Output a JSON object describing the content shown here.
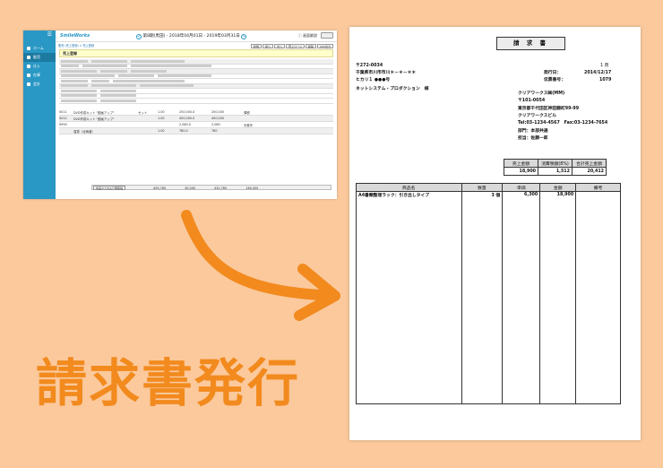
{
  "app": {
    "logo": "SmileWorks",
    "period": "第8期(黒田) - 2018年04月01日 - 2019年03月31日",
    "period_prev": "<",
    "period_next": ">",
    "help": "ⓘ 画面解説",
    "sidebar": [
      {
        "label": "ホーム",
        "icon": "home-icon",
        "active": false
      },
      {
        "label": "販売",
        "icon": "sales-icon",
        "active": true
      },
      {
        "label": "仕入",
        "icon": "purchase-icon",
        "active": false
      },
      {
        "label": "在庫",
        "icon": "stock-icon",
        "active": false
      },
      {
        "label": "会計",
        "icon": "accounting-icon",
        "active": false
      }
    ],
    "breadcrumb": "販売 (売上登録) > 売上登録",
    "toolbar": [
      "新規",
      "前へ",
      "次へ",
      "売上ページ",
      "削除",
      "CSV出力"
    ],
    "form_title": "売上登録",
    "form_buttons": [
      "Q",
      "検索",
      "保存"
    ],
    "lines": [
      {
        "col1": "0011",
        "col2": "DVD作成キット \"動画アップ\"",
        "col3": "セット",
        "qty": "1.00",
        "price": "250,000.0",
        "amount": "250,000",
        "tax": "課税"
      },
      {
        "col1": "0012",
        "col2": "DVD作成キット \"動画アップ\"",
        "col3": "",
        "qty": "1.00",
        "price": "400,000.0",
        "amount": "400,000",
        "tax": ""
      },
      {
        "col1": "9999",
        "col2": "",
        "col3": "",
        "qty": "",
        "price": "2,080.0",
        "amount": "2,080",
        "tax": "対象外"
      },
      {
        "col1": "",
        "col2": "運賃（北海道）",
        "col3": "",
        "qty": "1.00",
        "price": "780.0",
        "amount": "780",
        "tax": ""
      }
    ],
    "footer": {
      "label": "商品マスタより再取得",
      "subtotal": "409,760",
      "tax": "30,000",
      "total": "432,760",
      "other": "146,000"
    }
  },
  "headline": "請求書発行",
  "invoice": {
    "title": "請 求 書",
    "page": "1 頁",
    "postal": "〒272-0034",
    "address": "千葉県市川市市川＊－＊－＊＊",
    "building": "ヒカリ１ ●●●号",
    "company": "ネットシステム・プロダクション　様",
    "issue_date_label": "発行日：",
    "issue_date": "2014/12/17",
    "slip_label": "伝票番号：",
    "slip_no": "1079",
    "issuer": [
      "クリアワークス㈱(MM)",
      "〒101-0054",
      "東京都千代田区神田錦町99-99",
      "クリアワークスビル",
      "Tel:03-1234-4567　Fax:03-1234-7654",
      "部門：本部共通",
      "担当：佐藤一郎"
    ],
    "summary": {
      "headers": [
        "売上金額",
        "消費税額(8%)",
        "合計売上金額"
      ],
      "values": [
        "18,900",
        "1,512",
        "20,412"
      ]
    },
    "items": {
      "headers": [
        "商品名",
        "数量",
        "単価",
        "金額",
        "備考"
      ],
      "rows": [
        {
          "name": "A4書類整理ラック：引き出しタイプ",
          "qty": "3 個",
          "price": "6,300",
          "amount": "18,900",
          "note": ""
        }
      ]
    }
  }
}
